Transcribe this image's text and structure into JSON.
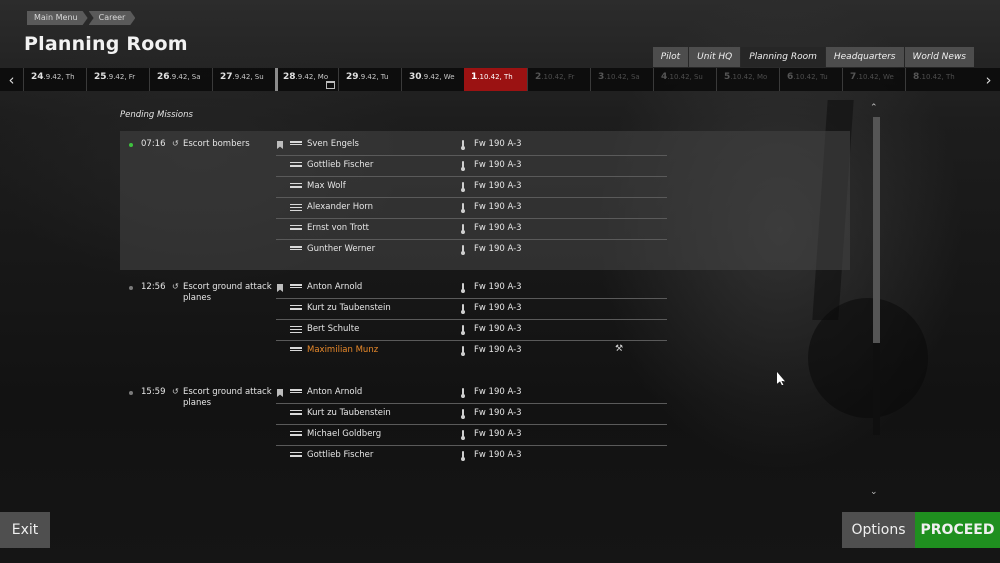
{
  "breadcrumb": [
    "Main Menu",
    "Career"
  ],
  "page_title": "Planning Room",
  "tabs": [
    {
      "label": "Pilot",
      "active": false
    },
    {
      "label": "Unit HQ",
      "active": false
    },
    {
      "label": "Planning Room",
      "active": true
    },
    {
      "label": "Headquarters",
      "active": false
    },
    {
      "label": "World News",
      "active": false
    }
  ],
  "dates": [
    {
      "day": "24",
      "rest": ".9.42, Th",
      "state": "past"
    },
    {
      "day": "25",
      "rest": ".9.42, Fr",
      "state": "past"
    },
    {
      "day": "26",
      "rest": ".9.42, Sa",
      "state": "past"
    },
    {
      "day": "27",
      "rest": ".9.42, Su",
      "state": "past"
    },
    {
      "day": "28",
      "rest": ".9.42, Mo",
      "state": "past-sel"
    },
    {
      "day": "29",
      "rest": ".9.42, Tu",
      "state": "past"
    },
    {
      "day": "30",
      "rest": ".9.42, We",
      "state": "past"
    },
    {
      "day": "1",
      "rest": ".10.42, Th",
      "state": "current"
    },
    {
      "day": "2",
      "rest": ".10.42, Fr",
      "state": "future"
    },
    {
      "day": "3",
      "rest": ".10.42, Sa",
      "state": "future"
    },
    {
      "day": "4",
      "rest": ".10.42, Su",
      "state": "future"
    },
    {
      "day": "5",
      "rest": ".10.42, Mo",
      "state": "future"
    },
    {
      "day": "6",
      "rest": ".10.42, Tu",
      "state": "future"
    },
    {
      "day": "7",
      "rest": ".10.42, We",
      "state": "future"
    },
    {
      "day": "8",
      "rest": ".10.42, Th",
      "state": "future"
    }
  ],
  "section_title": "Pending Missions",
  "missions": [
    {
      "time": "07:16",
      "type": "Escort bombers",
      "active": true,
      "pilots": [
        {
          "name": "Sven Engels",
          "plane": "Fw 190 A-3",
          "rank": 2
        },
        {
          "name": "Gottlieb Fischer",
          "plane": "Fw 190 A-3",
          "rank": 1
        },
        {
          "name": "Max Wolf",
          "plane": "Fw 190 A-3",
          "rank": 1
        },
        {
          "name": "Alexander Horn",
          "plane": "Fw 190 A-3",
          "rank": 3
        },
        {
          "name": "Ernst von Trott",
          "plane": "Fw 190 A-3",
          "rank": 1
        },
        {
          "name": "Gunther Werner",
          "plane": "Fw 190 A-3",
          "rank": 2
        }
      ]
    },
    {
      "time": "12:56",
      "type": "Escort ground attack planes",
      "active": false,
      "pilots": [
        {
          "name": "Anton Arnold",
          "plane": "Fw 190 A-3",
          "rank": 2
        },
        {
          "name": "Kurt zu Taubenstein",
          "plane": "Fw 190 A-3",
          "rank": 1
        },
        {
          "name": "Bert Schulte",
          "plane": "Fw 190 A-3",
          "rank": 3
        },
        {
          "name": "Maximilian Munz",
          "plane": "Fw 190 A-3",
          "rank": 2,
          "highlight": true,
          "wrench": true
        }
      ]
    },
    {
      "time": "15:59",
      "type": "Escort ground attack planes",
      "active": false,
      "pilots": [
        {
          "name": "Anton Arnold",
          "plane": "Fw 190 A-3",
          "rank": 2
        },
        {
          "name": "Kurt zu Taubenstein",
          "plane": "Fw 190 A-3",
          "rank": 1
        },
        {
          "name": "Michael Goldberg",
          "plane": "Fw 190 A-3",
          "rank": 1
        },
        {
          "name": "Gottlieb Fischer",
          "plane": "Fw 190 A-3",
          "rank": 1
        }
      ]
    }
  ],
  "buttons": {
    "exit": "Exit",
    "options": "Options",
    "proceed": "PROCEED"
  },
  "colors": {
    "accent_current_date": "#9b1212",
    "proceed": "#1f8f1f",
    "highlight_pilot": "#e8892a",
    "active_dot": "#3ec23e"
  }
}
